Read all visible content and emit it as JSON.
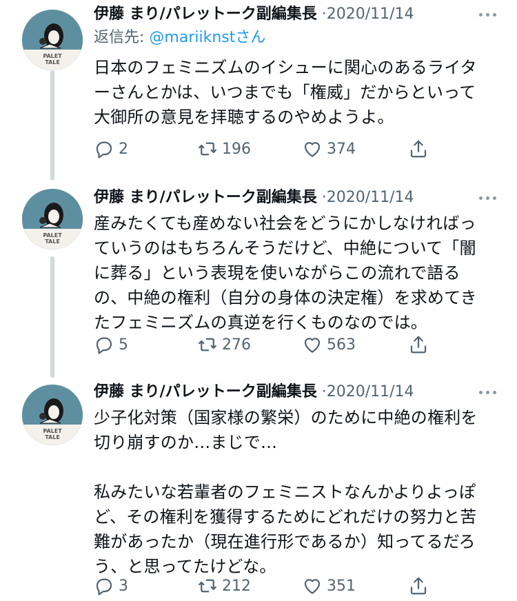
{
  "colors": {
    "link": "#1d9bf0",
    "secondary": "#536471",
    "thread_line": "#cfd9de",
    "avatar_bg": "#5e8fa0"
  },
  "avatar": {
    "logo_text_top": "PALET",
    "logo_text_bottom": "TALE"
  },
  "tweets": [
    {
      "name": "伊藤 まり/パレットーク副編集長",
      "separator": "·",
      "date": "2020/11/14",
      "reply_label": "返信先: ",
      "reply_handle": "@mariiknstさん",
      "lines": [
        "日本のフェミニズムのイシューに関心のあるライタ",
        "ーさんとかは、いつまでも「権威」だからといって",
        "大御所の意見を拝聴するのやめようよ。"
      ],
      "replies": "2",
      "retweets": "196",
      "likes": "374"
    },
    {
      "name": "伊藤 まり/パレットーク副編集長",
      "separator": "·",
      "date": "2020/11/14",
      "lines": [
        "産みたくても産めない社会をどうにかしなければっ",
        "ていうのはもちろんそうだけど、中絶について「闇",
        "に葬る」という表現を使いながらこの流れで語る",
        "の、中絶の権利（自分の身体の決定権）を求めてき",
        "たフェミニズムの真逆を行くものなのでは。"
      ],
      "replies": "5",
      "retweets": "276",
      "likes": "563"
    },
    {
      "name": "伊藤 まり/パレットーク副編集長",
      "separator": "·",
      "date": "2020/11/14",
      "lines": [
        "少子化対策（国家様の繁栄）のために中絶の権利を",
        "切り崩すのか…まじで…",
        "",
        "私みたいな若輩者のフェミニストなんかよりよっぽ",
        "ど、その権利を獲得するためにどれだけの努力と苦",
        "難があったか（現在進行形であるか）知ってるだろ",
        "う、と思ってたけどな。"
      ],
      "replies": "3",
      "retweets": "212",
      "likes": "351"
    }
  ]
}
